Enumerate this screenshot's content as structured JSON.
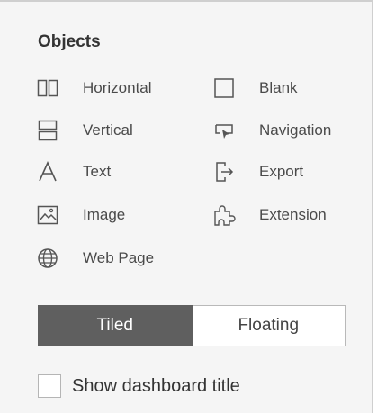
{
  "panel": {
    "title": "Objects"
  },
  "objects": {
    "horizontal": {
      "label": "Horizontal",
      "icon": "horizontal-container-icon"
    },
    "blank": {
      "label": "Blank",
      "icon": "blank-icon"
    },
    "vertical": {
      "label": "Vertical",
      "icon": "vertical-container-icon"
    },
    "navigation": {
      "label": "Navigation",
      "icon": "navigation-icon"
    },
    "text": {
      "label": "Text",
      "icon": "text-icon"
    },
    "export": {
      "label": "Export",
      "icon": "export-icon"
    },
    "image": {
      "label": "Image",
      "icon": "image-icon"
    },
    "extension": {
      "label": "Extension",
      "icon": "extension-icon"
    },
    "webpage": {
      "label": "Web Page",
      "icon": "globe-icon"
    }
  },
  "layout_toggle": {
    "tiled_label": "Tiled",
    "floating_label": "Floating",
    "selected": "Tiled"
  },
  "show_title": {
    "label": "Show dashboard title",
    "checked": false
  },
  "colors": {
    "panel_bg": "#f5f5f5",
    "active_segment": "#5f5f5f",
    "icon": "#555555"
  }
}
